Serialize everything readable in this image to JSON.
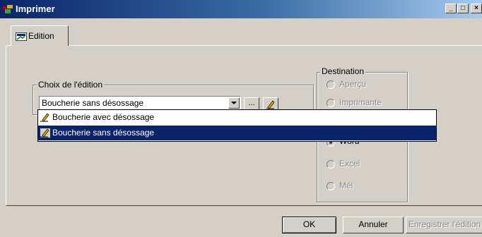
{
  "window": {
    "title": "Imprimer"
  },
  "title_buttons": {
    "minimize": "_",
    "maximize": "□",
    "close": "×"
  },
  "tabs": [
    {
      "label": "Edition",
      "active": true
    }
  ],
  "choix_edition": {
    "legend": "Choix de l'édition",
    "selected_value": "Boucherie sans désossage",
    "browse_label": "...",
    "edit_icon": "pencil-icon"
  },
  "dropdown": {
    "items": [
      {
        "label": "Boucherie avec désossage",
        "selected": false
      },
      {
        "label": "Boucherie sans désossage",
        "selected": true
      }
    ]
  },
  "destination": {
    "legend": "Destination",
    "options": [
      {
        "label": "Aperçu",
        "checked": false,
        "enabled": false
      },
      {
        "label": "Imprimante",
        "checked": false,
        "enabled": false
      },
      {
        "label": "Word",
        "checked": true,
        "enabled": true
      },
      {
        "label": "Excel",
        "checked": false,
        "enabled": false
      },
      {
        "label": "Mél",
        "checked": false,
        "enabled": false
      }
    ]
  },
  "buttons": {
    "ok": "OK",
    "cancel": "Annuler",
    "save": "Enregistrer l'édition"
  },
  "colors": {
    "titlebar_start": "#0a246a",
    "titlebar_end": "#a6caf0",
    "selection": "#0a246a",
    "face": "#d4d0c8"
  }
}
